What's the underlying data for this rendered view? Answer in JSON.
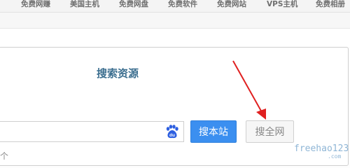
{
  "top_nav": {
    "items": [
      "免费网赚",
      "美国主机",
      "免费网盘",
      "免费软件",
      "免费网站",
      "VPS主机",
      "免费相册"
    ]
  },
  "search_panel": {
    "title": "搜索资源",
    "input_value": "",
    "search_site_button": "搜本站",
    "search_all_button": "搜全网",
    "baidu_icon": "baidu-paw-icon",
    "left_fragment": "个"
  },
  "annotation": {
    "arrow_color": "#e02020"
  },
  "watermark": {
    "main": "freehao123",
    "sub": ".com"
  },
  "colors": {
    "title_color": "#3b6e8f",
    "primary_button": "#3b8ff0",
    "baidu_blue": "#2d5fe0",
    "nav_text": "#6f6f6f"
  }
}
